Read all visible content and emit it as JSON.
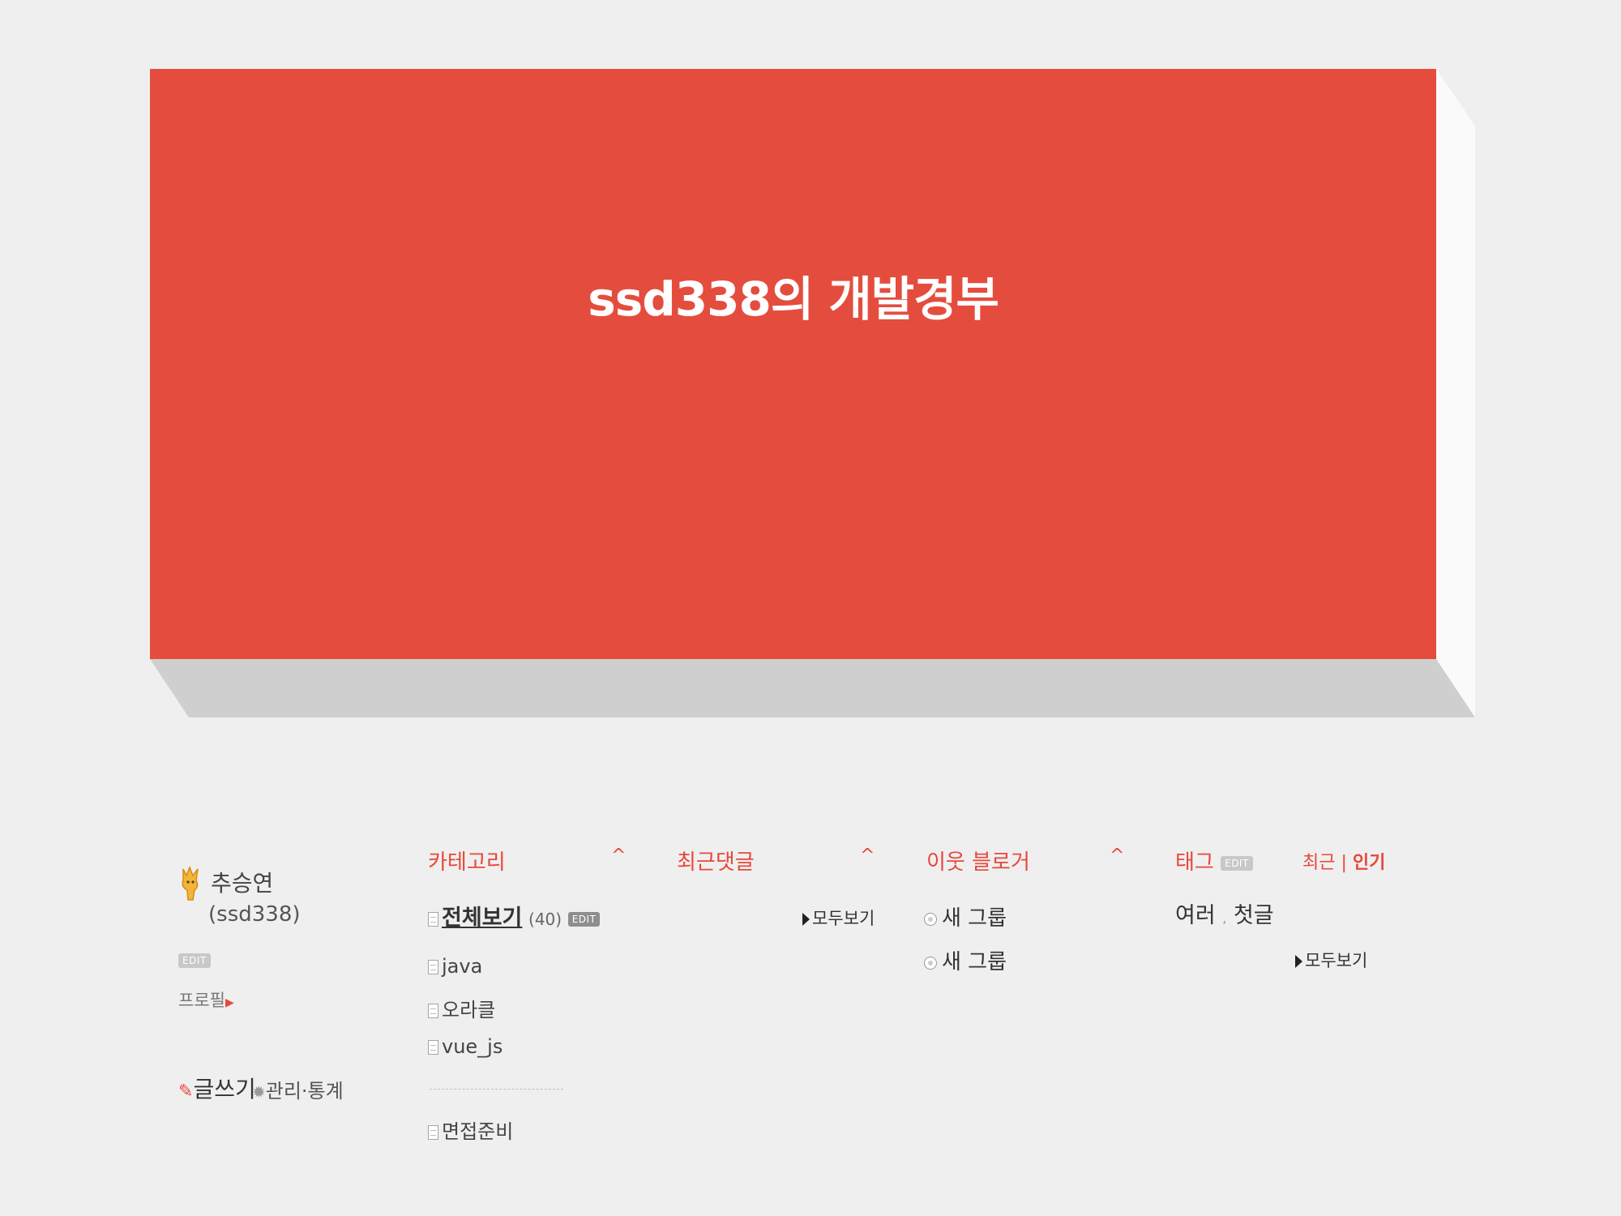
{
  "banner": {
    "title": "ssd338의 개발경부"
  },
  "profile": {
    "name": "추승연",
    "id": "(ssd338)",
    "edit_badge": "EDIT",
    "profile_link": "프로필",
    "write_label": "글쓰기",
    "manage_label": "관리·통계"
  },
  "category": {
    "heading": "카테고리",
    "caret": "^",
    "all_label": "전체보기",
    "all_count": "(40)",
    "edit_badge": "EDIT",
    "items": [
      "java",
      "오라클",
      "vue_js"
    ],
    "extra_item": "면접준비"
  },
  "recent_comments": {
    "heading": "최근댓글",
    "caret": "^",
    "more": "모두보기"
  },
  "neighbors": {
    "heading": "이웃 블로거",
    "caret": "^",
    "groups": [
      "새 그룹",
      "새 그룹"
    ]
  },
  "tags": {
    "heading": "태그",
    "edit_badge": "EDIT",
    "sort_recent": "최근",
    "sort_sep": "|",
    "sort_popular": "인기",
    "tag1": "여러",
    "tag_sep": ",",
    "tag2": "첫글",
    "more": "모두보기"
  },
  "colors": {
    "banner": "#e44d3e",
    "accent": "#e8473b",
    "background": "#efefef"
  }
}
